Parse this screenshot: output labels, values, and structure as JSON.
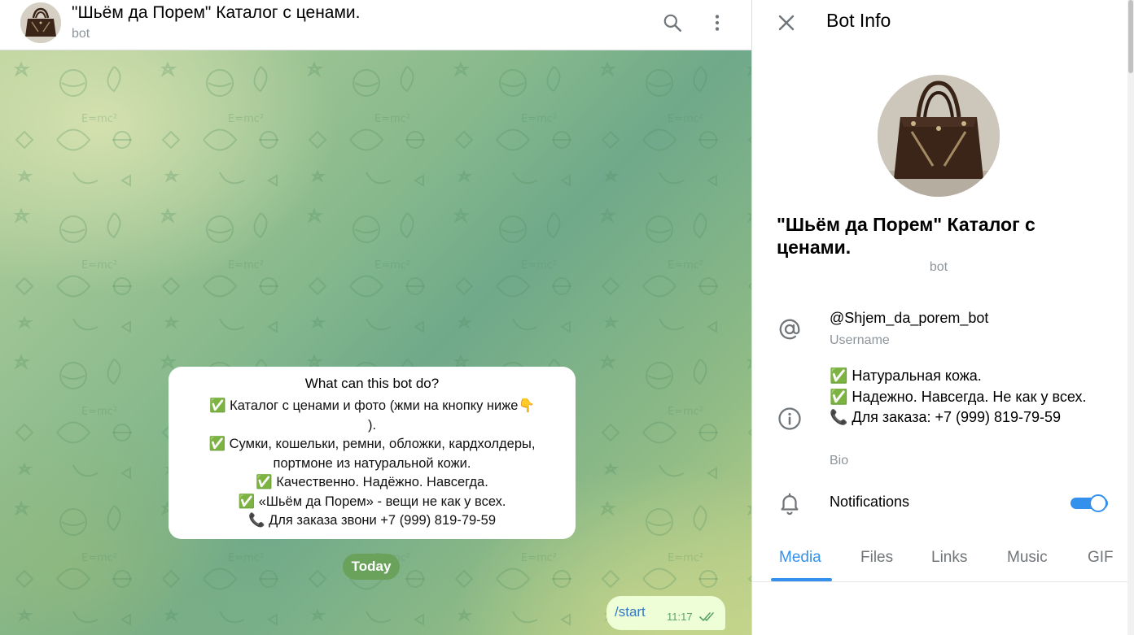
{
  "chat_header": {
    "title": "\"Шьём да Порем\" Каталог с ценами.",
    "subtitle": "bot",
    "search_icon": "search-icon",
    "menu_icon": "more-vertical-icon"
  },
  "intro_card": {
    "title": "What can this bot do?",
    "lines": [
      "✅ Каталог с ценами и фото (жми на кнопку ниже👇",
      ").",
      "✅ Сумки, кошельки, ремни, обложки, кардхолдеры,",
      "портмоне из натуральной кожи.",
      "✅  Качественно. Надёжно. Навсегда.",
      "✅ «Шьём да Порем» - вещи не как у всех.",
      "📞 Для заказа звони  +7 (999) 819-79-59"
    ]
  },
  "date_badge": "Today",
  "outgoing_message": {
    "text": "/start",
    "time": "11:17",
    "status": "read"
  },
  "panel": {
    "title": "Bot Info",
    "close_icon": "close-icon",
    "name": "\"Шьём да Порем\" Каталог с ценами.",
    "type": "bot",
    "username": {
      "value": "@Shjem_da_porem_bot",
      "label": "Username",
      "icon": "at-sign-icon"
    },
    "bio": {
      "lines": [
        "✅ Натуральная кожа.",
        "✅ Надежно. Навсегда. Не как у всех.",
        "📞 Для заказа: +7 (999) 819-79-59"
      ],
      "label": "Bio",
      "icon": "info-icon"
    },
    "notifications": {
      "label": "Notifications",
      "enabled": true,
      "icon": "bell-icon"
    },
    "tabs": [
      "Media",
      "Files",
      "Links",
      "Music",
      "GIF"
    ],
    "active_tab": "Media"
  },
  "colors": {
    "accent": "#3390ec",
    "outgoing_bubble": "#eefed7",
    "date_badge": "#6aa25c",
    "read_check": "#5aa463"
  }
}
